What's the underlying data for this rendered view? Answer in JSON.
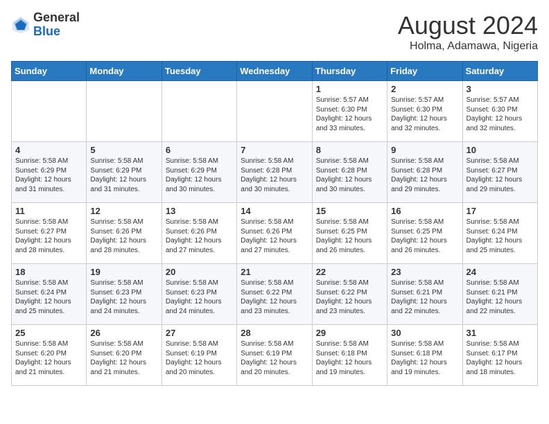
{
  "logo": {
    "general": "General",
    "blue": "Blue"
  },
  "title": "August 2024",
  "location": "Holma, Adamawa, Nigeria",
  "weekdays": [
    "Sunday",
    "Monday",
    "Tuesday",
    "Wednesday",
    "Thursday",
    "Friday",
    "Saturday"
  ],
  "weeks": [
    [
      null,
      null,
      null,
      null,
      {
        "day": "1",
        "sunrise": "5:57 AM",
        "sunset": "6:30 PM",
        "daylight": "12 hours and 33 minutes."
      },
      {
        "day": "2",
        "sunrise": "5:57 AM",
        "sunset": "6:30 PM",
        "daylight": "12 hours and 32 minutes."
      },
      {
        "day": "3",
        "sunrise": "5:57 AM",
        "sunset": "6:30 PM",
        "daylight": "12 hours and 32 minutes."
      }
    ],
    [
      {
        "day": "4",
        "sunrise": "5:58 AM",
        "sunset": "6:29 PM",
        "daylight": "12 hours and 31 minutes."
      },
      {
        "day": "5",
        "sunrise": "5:58 AM",
        "sunset": "6:29 PM",
        "daylight": "12 hours and 31 minutes."
      },
      {
        "day": "6",
        "sunrise": "5:58 AM",
        "sunset": "6:29 PM",
        "daylight": "12 hours and 30 minutes."
      },
      {
        "day": "7",
        "sunrise": "5:58 AM",
        "sunset": "6:28 PM",
        "daylight": "12 hours and 30 minutes."
      },
      {
        "day": "8",
        "sunrise": "5:58 AM",
        "sunset": "6:28 PM",
        "daylight": "12 hours and 30 minutes."
      },
      {
        "day": "9",
        "sunrise": "5:58 AM",
        "sunset": "6:28 PM",
        "daylight": "12 hours and 29 minutes."
      },
      {
        "day": "10",
        "sunrise": "5:58 AM",
        "sunset": "6:27 PM",
        "daylight": "12 hours and 29 minutes."
      }
    ],
    [
      {
        "day": "11",
        "sunrise": "5:58 AM",
        "sunset": "6:27 PM",
        "daylight": "12 hours and 28 minutes."
      },
      {
        "day": "12",
        "sunrise": "5:58 AM",
        "sunset": "6:26 PM",
        "daylight": "12 hours and 28 minutes."
      },
      {
        "day": "13",
        "sunrise": "5:58 AM",
        "sunset": "6:26 PM",
        "daylight": "12 hours and 27 minutes."
      },
      {
        "day": "14",
        "sunrise": "5:58 AM",
        "sunset": "6:26 PM",
        "daylight": "12 hours and 27 minutes."
      },
      {
        "day": "15",
        "sunrise": "5:58 AM",
        "sunset": "6:25 PM",
        "daylight": "12 hours and 26 minutes."
      },
      {
        "day": "16",
        "sunrise": "5:58 AM",
        "sunset": "6:25 PM",
        "daylight": "12 hours and 26 minutes."
      },
      {
        "day": "17",
        "sunrise": "5:58 AM",
        "sunset": "6:24 PM",
        "daylight": "12 hours and 25 minutes."
      }
    ],
    [
      {
        "day": "18",
        "sunrise": "5:58 AM",
        "sunset": "6:24 PM",
        "daylight": "12 hours and 25 minutes."
      },
      {
        "day": "19",
        "sunrise": "5:58 AM",
        "sunset": "6:23 PM",
        "daylight": "12 hours and 24 minutes."
      },
      {
        "day": "20",
        "sunrise": "5:58 AM",
        "sunset": "6:23 PM",
        "daylight": "12 hours and 24 minutes."
      },
      {
        "day": "21",
        "sunrise": "5:58 AM",
        "sunset": "6:22 PM",
        "daylight": "12 hours and 23 minutes."
      },
      {
        "day": "22",
        "sunrise": "5:58 AM",
        "sunset": "6:22 PM",
        "daylight": "12 hours and 23 minutes."
      },
      {
        "day": "23",
        "sunrise": "5:58 AM",
        "sunset": "6:21 PM",
        "daylight": "12 hours and 22 minutes."
      },
      {
        "day": "24",
        "sunrise": "5:58 AM",
        "sunset": "6:21 PM",
        "daylight": "12 hours and 22 minutes."
      }
    ],
    [
      {
        "day": "25",
        "sunrise": "5:58 AM",
        "sunset": "6:20 PM",
        "daylight": "12 hours and 21 minutes."
      },
      {
        "day": "26",
        "sunrise": "5:58 AM",
        "sunset": "6:20 PM",
        "daylight": "12 hours and 21 minutes."
      },
      {
        "day": "27",
        "sunrise": "5:58 AM",
        "sunset": "6:19 PM",
        "daylight": "12 hours and 20 minutes."
      },
      {
        "day": "28",
        "sunrise": "5:58 AM",
        "sunset": "6:19 PM",
        "daylight": "12 hours and 20 minutes."
      },
      {
        "day": "29",
        "sunrise": "5:58 AM",
        "sunset": "6:18 PM",
        "daylight": "12 hours and 19 minutes."
      },
      {
        "day": "30",
        "sunrise": "5:58 AM",
        "sunset": "6:18 PM",
        "daylight": "12 hours and 19 minutes."
      },
      {
        "day": "31",
        "sunrise": "5:58 AM",
        "sunset": "6:17 PM",
        "daylight": "12 hours and 18 minutes."
      }
    ]
  ]
}
